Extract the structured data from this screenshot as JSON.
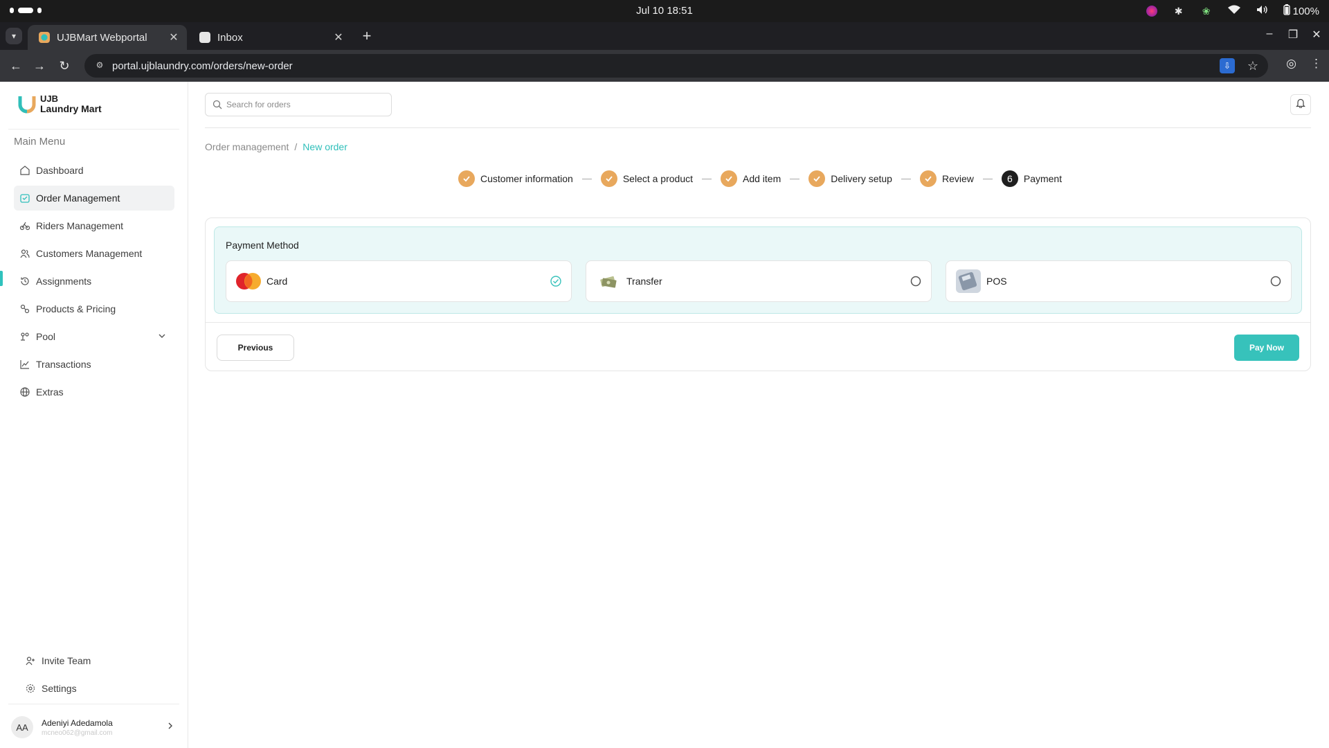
{
  "os": {
    "clock": "Jul 10  18:51",
    "battery": "100%"
  },
  "browser": {
    "tabs": [
      {
        "title": "UJBMart Webportal",
        "active": true
      },
      {
        "title": "Inbox",
        "active": false
      }
    ],
    "url": "portal.ujblaundry.com/orders/new-order"
  },
  "sidebar": {
    "logo_line1": "UJB",
    "logo_line2": "Laundry Mart",
    "menu_label": "Main Menu",
    "items": [
      {
        "label": "Dashboard",
        "icon": "home-icon"
      },
      {
        "label": "Order Management",
        "icon": "calendar-icon",
        "active": true
      },
      {
        "label": "Riders Management",
        "icon": "bike-icon"
      },
      {
        "label": "Customers Management",
        "icon": "users-icon"
      },
      {
        "label": "Assignments",
        "icon": "history-icon"
      },
      {
        "label": "Products & Pricing",
        "icon": "tags-icon"
      },
      {
        "label": "Pool",
        "icon": "pool-icon",
        "expandable": true
      },
      {
        "label": "Transactions",
        "icon": "chart-line-icon"
      },
      {
        "label": "Extras",
        "icon": "globe-icon"
      }
    ],
    "bottom_items": [
      {
        "label": "Invite Team",
        "icon": "user-plus-icon"
      },
      {
        "label": "Settings",
        "icon": "gear-icon"
      }
    ],
    "user": {
      "initials": "AA",
      "name": "Adeniyi Adedamola",
      "email": "mcneo062@gmail.com"
    }
  },
  "header": {
    "search_placeholder": "Search for orders"
  },
  "breadcrumb": {
    "parent": "Order management",
    "separator": "/",
    "current": "New order"
  },
  "stepper": {
    "steps": [
      {
        "label": "Customer information",
        "status": "complete"
      },
      {
        "label": "Select a product",
        "status": "complete"
      },
      {
        "label": "Add item",
        "status": "complete"
      },
      {
        "label": "Delivery setup",
        "status": "complete"
      },
      {
        "label": "Review",
        "status": "complete"
      },
      {
        "label": "Payment",
        "status": "current",
        "number": "6"
      }
    ]
  },
  "payment": {
    "title": "Payment Method",
    "options": [
      {
        "label": "Card",
        "icon": "mastercard-icon",
        "selected": true
      },
      {
        "label": "Transfer",
        "icon": "cash-transfer-icon",
        "selected": false
      },
      {
        "label": "POS",
        "icon": "pos-terminal-icon",
        "selected": false
      }
    ]
  },
  "actions": {
    "previous": "Previous",
    "pay_now": "Pay Now"
  },
  "colors": {
    "accent": "#37c2bb",
    "step_complete": "#e8a85d",
    "payment_box_bg": "#eaf8f8"
  }
}
